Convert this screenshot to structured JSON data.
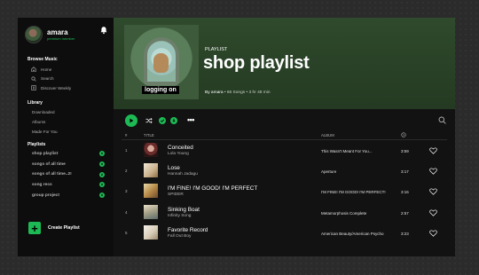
{
  "user": {
    "name": "amara",
    "status": "premium member"
  },
  "sidebar": {
    "browse_title": "Browse Music",
    "browse_items": [
      {
        "label": "Home",
        "icon": "home-icon"
      },
      {
        "label": "Search",
        "icon": "search-icon"
      },
      {
        "label": "Discover Weekly",
        "icon": "discover-icon"
      }
    ],
    "library_title": "Library",
    "library_items": [
      "Downloaded",
      "Albums",
      "Made For You"
    ],
    "playlists_title": "Playlists",
    "playlists": [
      "shop playlist",
      "songs of all time",
      "songs of all time..2!",
      "song recs",
      "group project"
    ],
    "create_label": "Create Playlist"
  },
  "header": {
    "kind": "PLAYLIST",
    "title": "shop playlist",
    "cover_text": "logging on",
    "owner": "By amara",
    "song_count": "66 Songs",
    "duration": "3 hr 48 min"
  },
  "table": {
    "col_index": "#",
    "col_title": "TITLE",
    "col_album": "ALBUM",
    "col_duration_icon": "clock-icon"
  },
  "tracks": [
    {
      "index": "1",
      "title": "Conceited",
      "artist": "Lola Young",
      "album": "This Wasn't Meant For You...",
      "duration": "3:59"
    },
    {
      "index": "2",
      "title": "Lose",
      "artist": "Hannah Jadagu",
      "album": "Aperture",
      "duration": "3:17"
    },
    {
      "index": "3",
      "title": "I'M FINE! I'M GOOD! I'M PERFECT",
      "artist": "SPIDER",
      "album": "I'M FINE! I'M GOOD! I'M PERFECT!",
      "duration": "3:16"
    },
    {
      "index": "4",
      "title": "Sinking Boat",
      "artist": "Infinity Song",
      "album": "Metamorphosis Complete",
      "duration": "2:57"
    },
    {
      "index": "5",
      "title": "Favorite Record",
      "artist": "Fall Out Boy",
      "album": "American Beauty/American Psycho",
      "duration": "3:23"
    }
  ],
  "colors": {
    "accent": "#1db954",
    "header": "#2f4a2c",
    "sidebar": "#0d0d0d",
    "main": "#121212"
  }
}
